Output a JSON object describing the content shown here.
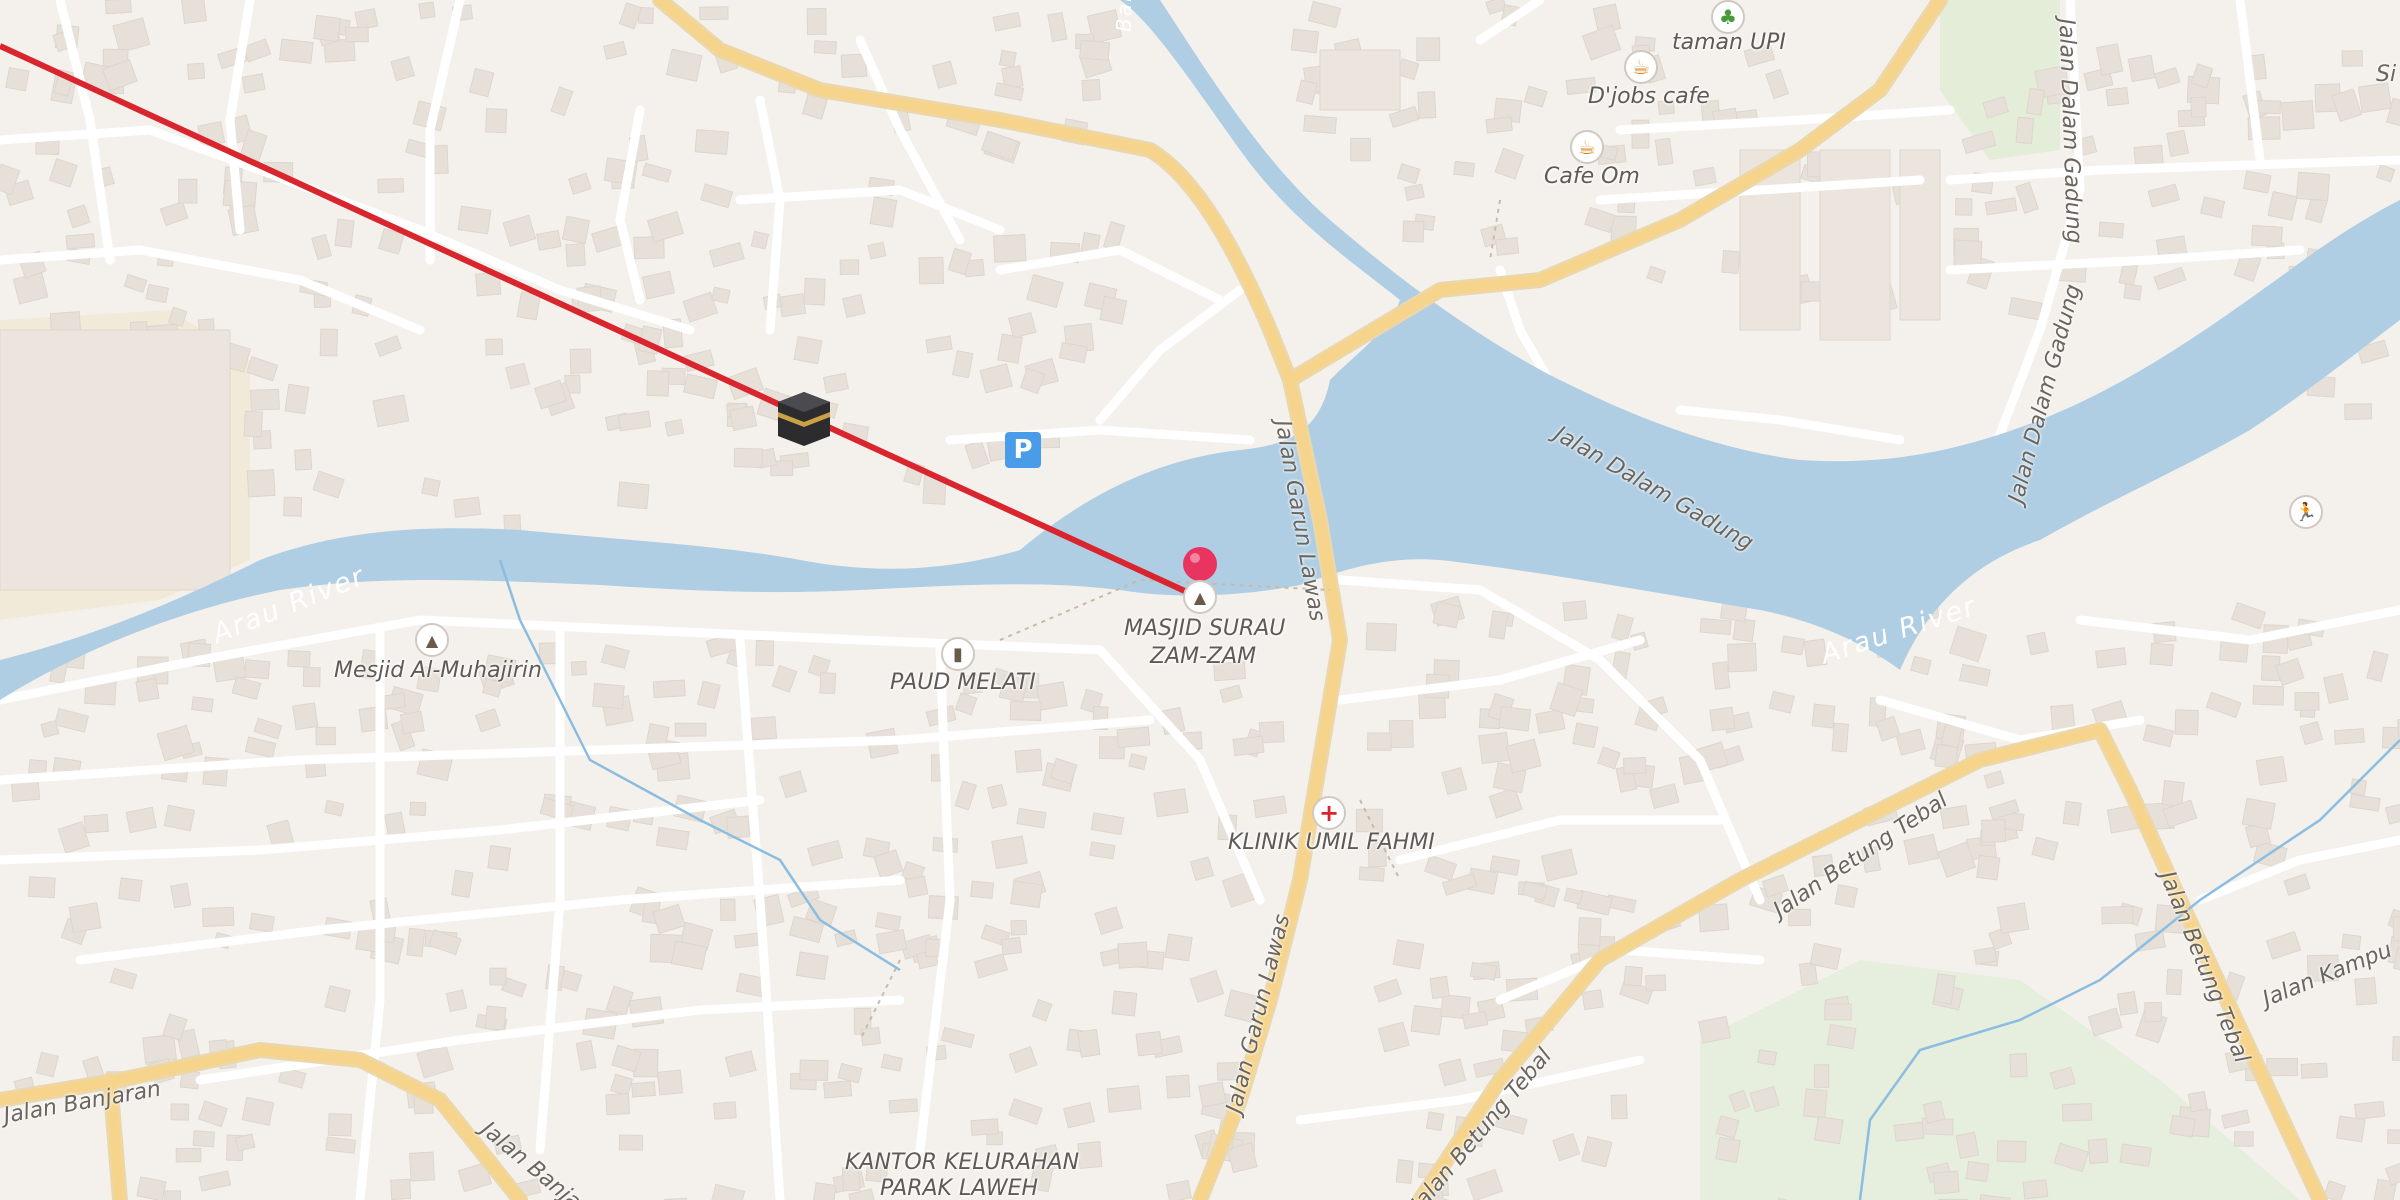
{
  "map": {
    "colors": {
      "land": "#f4f1ec",
      "water": "#afcde3",
      "major_road": "#f7d48b",
      "minor_road": "#ffffff",
      "building": "#e6e0d9",
      "direction_line": "#d9252e",
      "pin": "#e8345f",
      "park": "#e3edd8"
    },
    "labels": {
      "taman_upi": "taman UPI",
      "djobs_cafe": "D'jobs cafe",
      "cafe_om": "Cafe Om",
      "masjid_surau_line1": "MASJID SURAU",
      "masjid_surau_line2": "ZAM-ZAM",
      "mesjid_al_muhajirin": "Mesjid Al-Muhajirin",
      "paud_melati": "PAUD MELATI",
      "klinik": "KLINIK UMIL FAHMI",
      "kantor_line1": "KANTOR KELURAHAN",
      "kantor_line2": "PARAK LAWEH"
    },
    "streets": {
      "jalan_garun_lawas_north": "Jalan Garun Lawas",
      "jalan_garun_lawas_south": "Jalan Garun Lawas",
      "jalan_dalam_gadung": "Jalan Dalam Gadung",
      "jalan_dalam_gadung_vertical": "Jalan Dalam Gadung",
      "jalan_dalam_gadung_top": "Jalan Dalam Gadung",
      "jalan_betung_tebal_east": "Jalan Betung Tebal",
      "jalan_betung_tebal_south": "Jalan Betung Tebal",
      "jalan_betung_tebal_vertical": "Jalan Betung Tebal",
      "jalan_banjaran_west": "Jalan Banjaran",
      "jalan_banjaran_south": "Jalan Banja",
      "jalan_kampu": "Jalan Kampu",
      "edge_si": "Si"
    },
    "water": {
      "arau_river_west": "Arau River",
      "arau_river_east": "Arau River",
      "canal_top": "Banjir Kanal"
    },
    "icons": {
      "kaaba": "kaaba-icon",
      "parking": "P",
      "park": "tree-icon",
      "cafe": "cafe-icon",
      "mosque": "mosque-icon",
      "school": "school-icon",
      "clinic": "clinic-icon",
      "sports": "sports-icon",
      "location_pin": "location-pin-icon"
    }
  }
}
